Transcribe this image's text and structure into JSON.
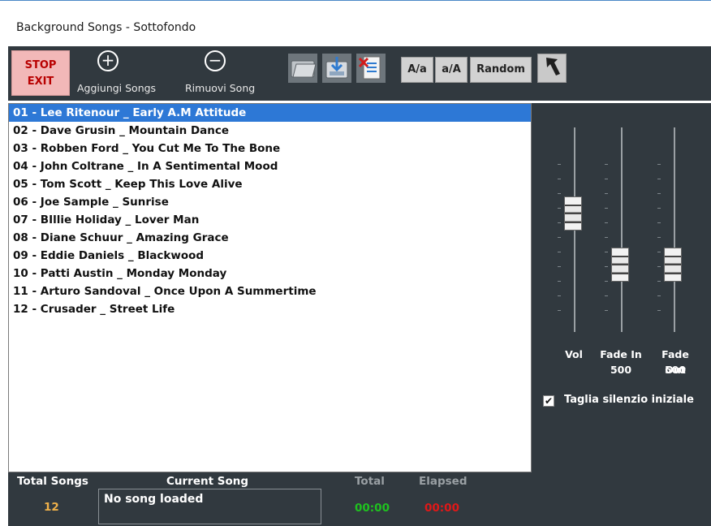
{
  "window": {
    "title": "Background Songs - Sottofondo"
  },
  "toolbar": {
    "stop_label_1": "STOP",
    "stop_label_2": "EXIT",
    "add_icon": "plus-circle-icon",
    "add_glyph": "+",
    "add_label": "Aggiungi Songs",
    "remove_icon": "minus-circle-icon",
    "remove_glyph": "−",
    "remove_label": "Rimuovi Song",
    "tools": [
      {
        "icon": "open-folder-icon"
      },
      {
        "icon": "save-list-icon"
      },
      {
        "icon": "clear-list-icon"
      }
    ],
    "case_lower_label": "A/a",
    "case_upper_label": "a/A",
    "random_label": "Random",
    "exit_arrow_icon": "back-arrow-icon"
  },
  "songs": {
    "selected_index": 0,
    "items": [
      "01 - Lee Ritenour _ Early A.M Attitude",
      "02 - Dave Grusin _ Mountain Dance",
      "03 - Robben Ford _ You Cut Me To The Bone",
      "04 - John Coltrane _ In A Sentimental Mood",
      "05 - Tom Scott _ Keep This Love Alive",
      "06 - Joe Sample _ Sunrise",
      "07 - BIllie Holiday _ Lover Man",
      "08 - Diane Schuur _ Amazing Grace",
      "09 - Eddie Daniels _ Blackwood",
      "10 - Patti Austin _ Monday Monday",
      "11 - Arturo Sandoval _ Once Upon A Summertime",
      "12 - Crusader _ Street Life"
    ]
  },
  "sliders": {
    "vol": {
      "label": "Vol",
      "level": 0.58
    },
    "fade_in": {
      "label": "Fade In",
      "value": "500",
      "level": 0.33
    },
    "fade_out": {
      "label": "Fade Out",
      "value": "500",
      "level": 0.33
    }
  },
  "options": {
    "trim_silence_label": "Taglia silenzio iniziale",
    "trim_silence_checked": true,
    "check_glyph": "✔"
  },
  "footer": {
    "total_songs_label": "Total Songs",
    "total_songs_value": "12",
    "current_song_label": "Current Song",
    "current_song_value": "No song loaded",
    "total_label": "Total",
    "total_value": "00:00",
    "elapsed_label": "Elapsed",
    "elapsed_value": "00:00"
  },
  "colors": {
    "panel_bg": "#31393f",
    "selection": "#2d78d6",
    "stop_bg": "#f2b8b8",
    "stop_text": "#b80000",
    "count_color": "#f0b24a",
    "total_time_color": "#1fc21f",
    "elapsed_time_color": "#e01818",
    "muted_label": "#9aa0a4"
  }
}
